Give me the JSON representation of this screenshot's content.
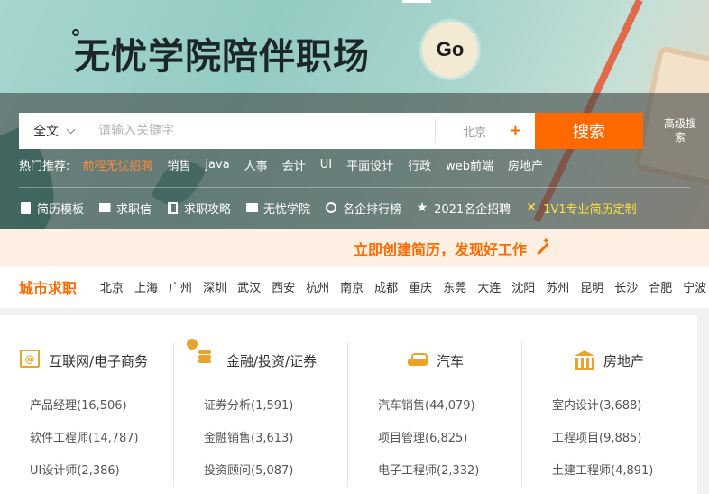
{
  "banner": {
    "slogan": "无忧学院陪伴职场",
    "go_label": "Go"
  },
  "search": {
    "scope_label": "全文",
    "keyword_placeholder": "请输入关键字",
    "city_value": "北京",
    "city_plus": "+",
    "button_label": "搜索",
    "advanced_label": "高级搜索"
  },
  "hot": {
    "label": "热门推荐:",
    "items": [
      "前程无忧招聘",
      "销售",
      "java",
      "人事",
      "会计",
      "UI",
      "平面设计",
      "行政",
      "web前端",
      "房地产"
    ]
  },
  "quick_links": [
    {
      "label": "简历模板",
      "icon": "document-icon"
    },
    {
      "label": "求职信",
      "icon": "mail-icon"
    },
    {
      "label": "求职攻略",
      "icon": "book-icon"
    },
    {
      "label": "无忧学院",
      "icon": "monitor-icon"
    },
    {
      "label": "名企排行榜",
      "icon": "medal-icon"
    },
    {
      "label": "2021名企招聘",
      "icon": "star-icon"
    },
    {
      "label": "1V1专业简历定制",
      "icon": "sparkle-icon"
    }
  ],
  "create_resume": "立即创建简历，发现好工作",
  "city_section": {
    "title": "城市求职",
    "cities": [
      "北京",
      "上海",
      "广州",
      "深圳",
      "武汉",
      "西安",
      "杭州",
      "南京",
      "成都",
      "重庆",
      "东莞",
      "大连",
      "沈阳",
      "苏州",
      "昆明",
      "长沙",
      "合肥",
      "宁波"
    ]
  },
  "categories": [
    {
      "title": "互联网/电子商务",
      "icon": "web-icon",
      "items": [
        "产品经理(16,506)",
        "软件工程师(14,787)",
        "UI设计师(2,386)"
      ]
    },
    {
      "title": "金融/投资/证券",
      "icon": "coins-icon",
      "items": [
        "证券分析(1,591)",
        "金融销售(3,613)",
        "投资顾问(5,087)"
      ]
    },
    {
      "title": "汽车",
      "icon": "car-icon",
      "items": [
        "汽车销售(44,079)",
        "项目管理(6,825)",
        "电子工程师(2,332)"
      ]
    },
    {
      "title": "房地产",
      "icon": "bank-icon",
      "items": [
        "室内设计(3,688)",
        "工程项目(9,885)",
        "土建工程师(4,891)"
      ]
    }
  ],
  "colors": {
    "accent": "#ff6a00",
    "highlight": "#ffe23a",
    "category_icon": "#e8a32b"
  }
}
